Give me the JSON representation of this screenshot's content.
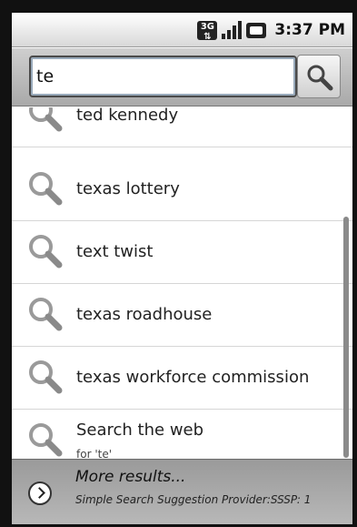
{
  "status_bar": {
    "network_label": "3G",
    "time": "3:37 PM"
  },
  "search": {
    "query": "te"
  },
  "suggestions": [
    {
      "label": "ted kennedy"
    },
    {
      "label": "texas lottery"
    },
    {
      "label": "text twist"
    },
    {
      "label": "texas roadhouse"
    },
    {
      "label": "texas workforce commission"
    },
    {
      "label": "Search the web",
      "sub": "for 'te'"
    }
  ],
  "footer": {
    "title": "More results...",
    "subtitle": "Simple Search Suggestion Provider:SSSP: 1"
  },
  "icons": {
    "search": "magnifier-icon",
    "more": "chevron-right-icon"
  },
  "colors": {
    "text": "#222222",
    "divider": "#d6d6d6"
  }
}
